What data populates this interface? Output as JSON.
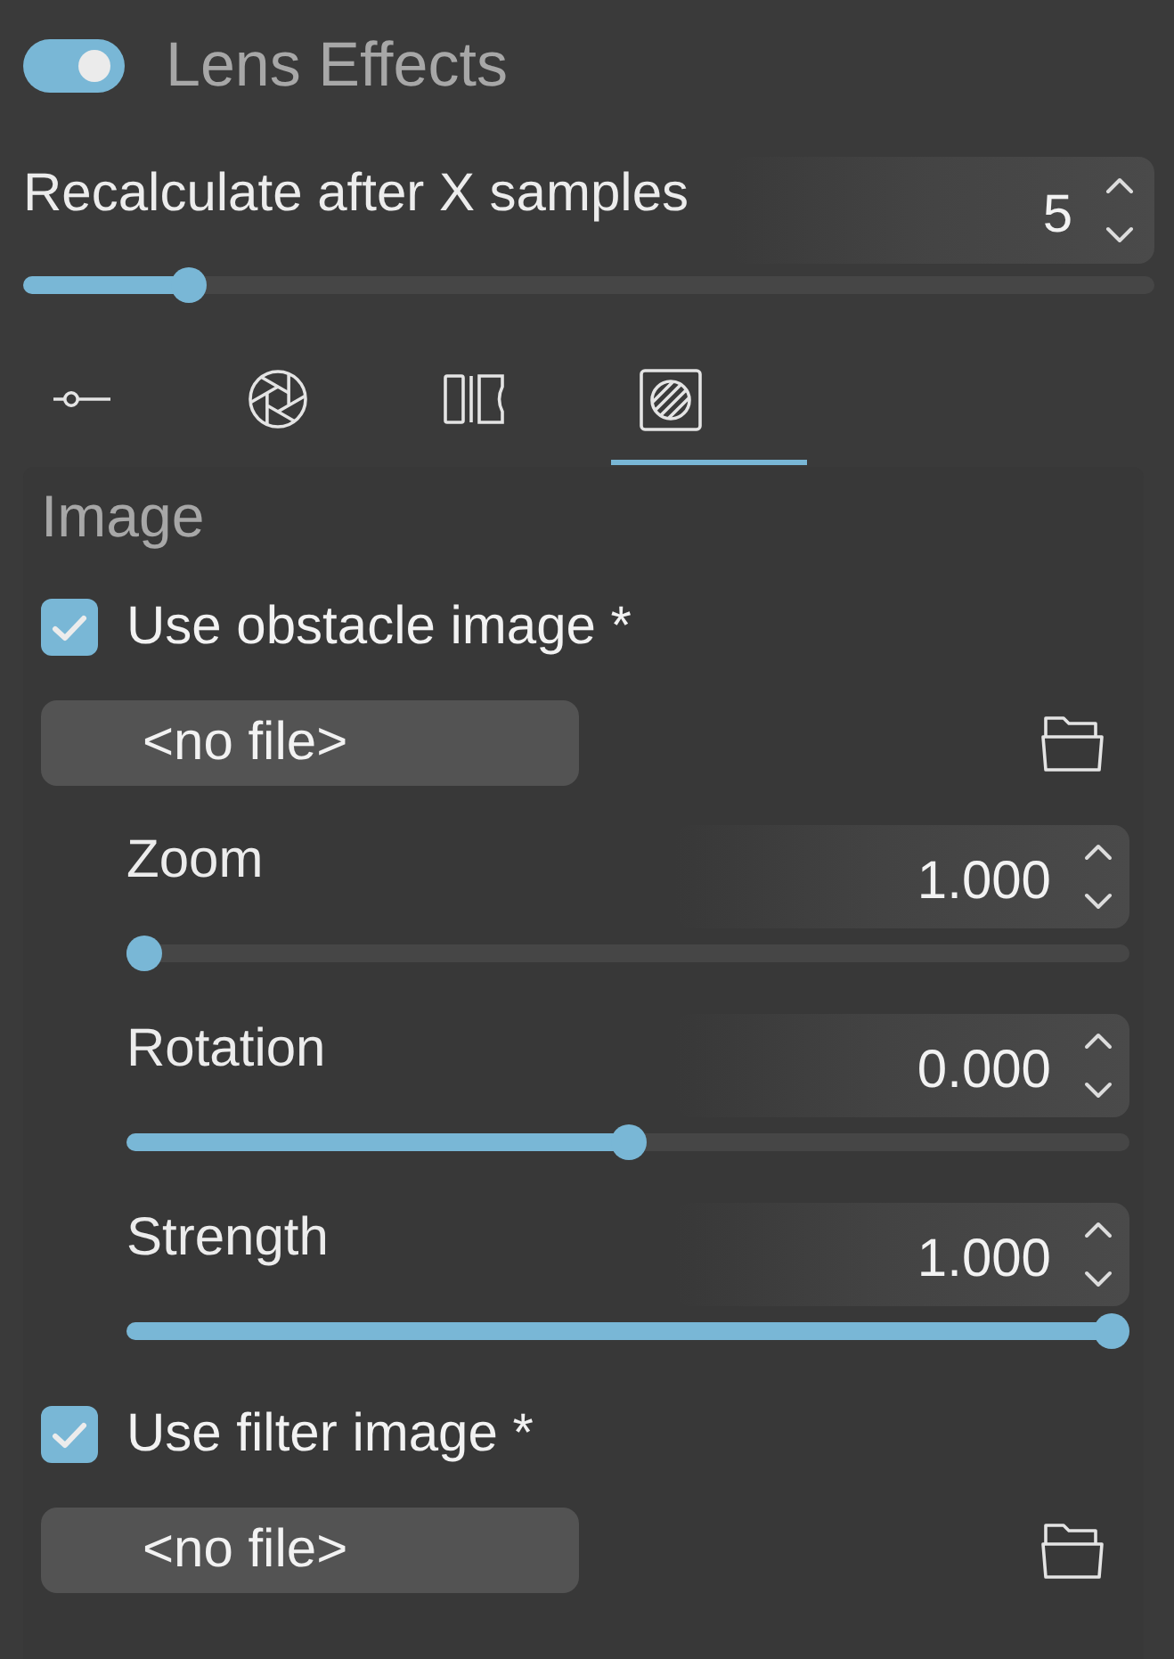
{
  "lens_effects": {
    "title": "Lens Effects",
    "on": true
  },
  "samples": {
    "label": "Recalculate after X samples",
    "value": "5",
    "level": 0.135
  },
  "tabs": [
    {
      "selected": false
    },
    {
      "selected": false
    },
    {
      "selected": false
    },
    {
      "selected": true
    }
  ],
  "image_section": {
    "heading": "Image",
    "obstacle": {
      "label": "Use obstacle image *",
      "checked": true,
      "file": "<no file>"
    },
    "parameters": [
      {
        "label": "Zoom",
        "value": "1.000",
        "level": 0
      },
      {
        "label": "Rotation",
        "value": "0.000",
        "level": 0.5
      },
      {
        "label": "Strength",
        "value": "1.000",
        "level": 1
      }
    ],
    "filter": {
      "label": "Use filter image *",
      "checked": true,
      "file": "<no file>"
    }
  }
}
